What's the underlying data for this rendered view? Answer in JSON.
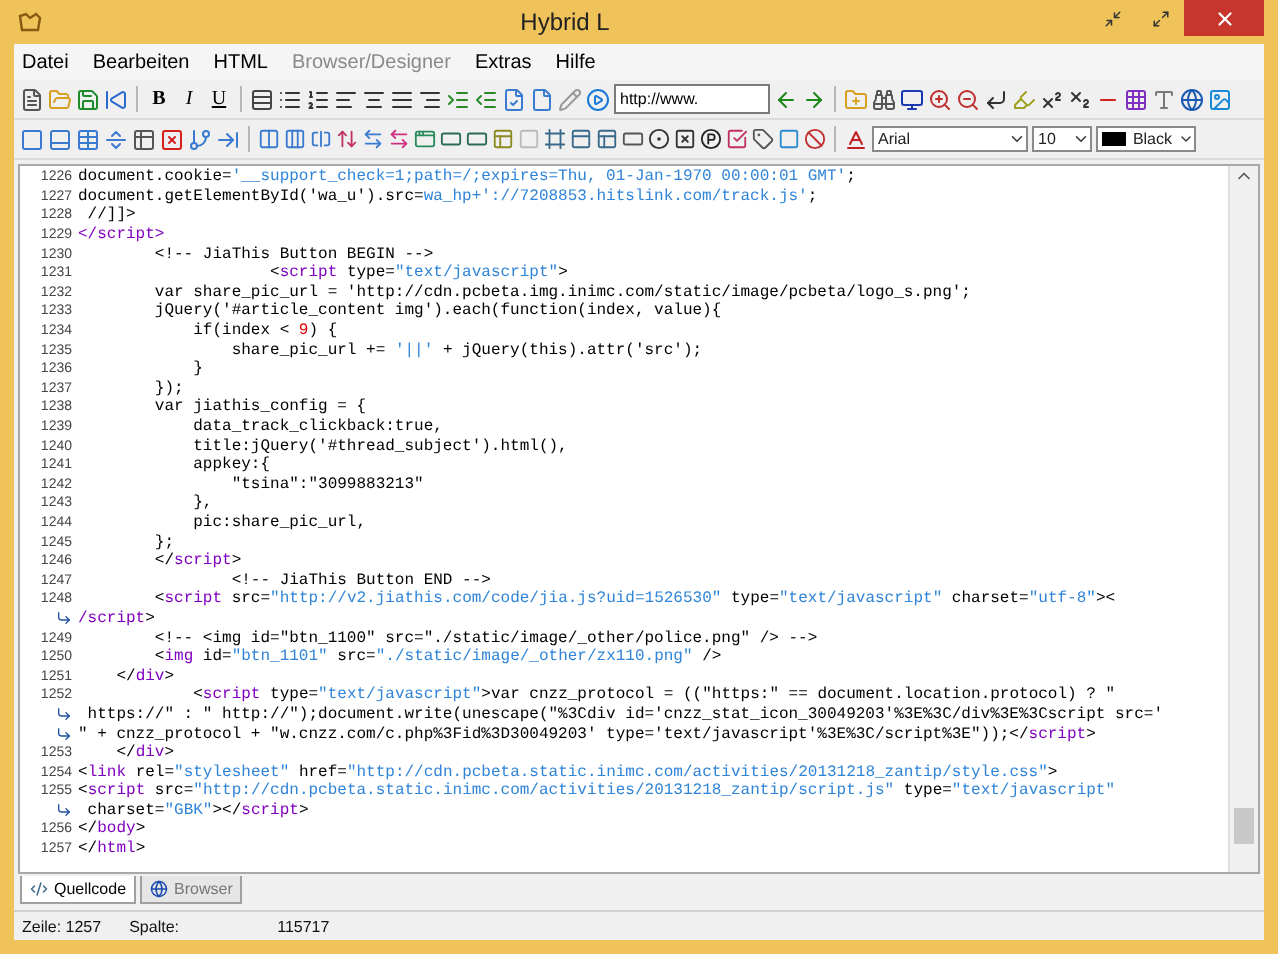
{
  "window": {
    "title": "Hybrid L"
  },
  "menu": [
    {
      "label": "Datei",
      "disabled": false
    },
    {
      "label": "Bearbeiten",
      "disabled": false
    },
    {
      "label": "HTML",
      "disabled": false
    },
    {
      "label": "Browser/Designer",
      "disabled": true
    },
    {
      "label": "Extras",
      "disabled": false
    },
    {
      "label": "Hilfe",
      "disabled": false
    }
  ],
  "format_buttons": [
    {
      "label": "B",
      "kind": "bold"
    },
    {
      "label": "I",
      "kind": "italic"
    },
    {
      "label": "U",
      "kind": "underline"
    }
  ],
  "url_field": {
    "value": "http://www."
  },
  "font_select": {
    "value": "Arial"
  },
  "size_select": {
    "value": "10"
  },
  "color_select": {
    "value": "Black",
    "color": "#000000"
  },
  "code_lines": [
    {
      "kind": "line",
      "number": "1226",
      "segments": [
        {
          "kind": "plain",
          "text": "document.cookie="
        },
        {
          "kind": "string",
          "text": "'__support_check=1;path=/;expires=Thu, 01-Jan-1970 00:00:01 GMT'"
        },
        {
          "kind": "plain",
          "text": ";"
        }
      ]
    },
    {
      "kind": "line",
      "number": "1227",
      "segments": [
        {
          "kind": "plain",
          "text": "document.getElementById('wa_u').src="
        },
        {
          "kind": "string",
          "text": "wa_hp+'://7208853.hitslink.com/track.js'"
        },
        {
          "kind": "plain",
          "text": ";"
        }
      ]
    },
    {
      "kind": "line",
      "number": "1228",
      "segments": [
        {
          "kind": "plain",
          "text": " //]]>"
        }
      ]
    },
    {
      "kind": "line",
      "number": "1229",
      "segments": [
        {
          "kind": "tag",
          "text": "</script>"
        }
      ]
    },
    {
      "kind": "line",
      "number": "1230",
      "segments": [
        {
          "kind": "plain",
          "text": "        <!-- JiaThis Button BEGIN -->"
        }
      ]
    },
    {
      "kind": "line",
      "number": "1231",
      "segments": [
        {
          "kind": "plain",
          "text": "                    <"
        },
        {
          "kind": "tag",
          "text": "script"
        },
        {
          "kind": "plain",
          "text": " type="
        },
        {
          "kind": "string",
          "text": "\"text/javascript\""
        },
        {
          "kind": "plain",
          "text": ">"
        }
      ]
    },
    {
      "kind": "line",
      "number": "1232",
      "segments": [
        {
          "kind": "plain",
          "text": "        var share_pic_url = 'http://cdn.pcbeta.img.inimc.com/static/image/pcbeta/logo_s.png';"
        }
      ]
    },
    {
      "kind": "line",
      "number": "1233",
      "segments": [
        {
          "kind": "plain",
          "text": "        jQuery('#article_content img').each(function(index, value){"
        }
      ]
    },
    {
      "kind": "line",
      "number": "1234",
      "segments": [
        {
          "kind": "plain",
          "text": "            if(index < "
        },
        {
          "kind": "number",
          "text": "9"
        },
        {
          "kind": "plain",
          "text": ") {"
        }
      ]
    },
    {
      "kind": "line",
      "number": "1235",
      "segments": [
        {
          "kind": "plain",
          "text": "                share_pic_url += "
        },
        {
          "kind": "string",
          "text": "'||'"
        },
        {
          "kind": "plain",
          "text": " + jQuery(this).attr('src');"
        }
      ]
    },
    {
      "kind": "line",
      "number": "1236",
      "segments": [
        {
          "kind": "plain",
          "text": "            }"
        }
      ]
    },
    {
      "kind": "line",
      "number": "1237",
      "segments": [
        {
          "kind": "plain",
          "text": "        });"
        }
      ]
    },
    {
      "kind": "line",
      "number": "1238",
      "segments": [
        {
          "kind": "plain",
          "text": "        var jiathis_config = {"
        }
      ]
    },
    {
      "kind": "line",
      "number": "1239",
      "segments": [
        {
          "kind": "plain",
          "text": "            data_track_clickback:true,"
        }
      ]
    },
    {
      "kind": "line",
      "number": "1240",
      "segments": [
        {
          "kind": "plain",
          "text": "            title:jQuery('#thread_subject').html(),"
        }
      ]
    },
    {
      "kind": "line",
      "number": "1241",
      "segments": [
        {
          "kind": "plain",
          "text": "            appkey:{"
        }
      ]
    },
    {
      "kind": "line",
      "number": "1242",
      "segments": [
        {
          "kind": "plain",
          "text": "                \"tsina\":\"3099883213\""
        }
      ]
    },
    {
      "kind": "line",
      "number": "1243",
      "segments": [
        {
          "kind": "plain",
          "text": "            },"
        }
      ]
    },
    {
      "kind": "line",
      "number": "1244",
      "segments": [
        {
          "kind": "plain",
          "text": "            pic:share_pic_url,"
        }
      ]
    },
    {
      "kind": "line",
      "number": "1245",
      "segments": [
        {
          "kind": "plain",
          "text": "        };"
        }
      ]
    },
    {
      "kind": "line",
      "number": "1246",
      "segments": [
        {
          "kind": "plain",
          "text": "        </"
        },
        {
          "kind": "tag",
          "text": "script"
        },
        {
          "kind": "plain",
          "text": ">"
        }
      ]
    },
    {
      "kind": "line",
      "number": "1247",
      "segments": [
        {
          "kind": "plain",
          "text": "                <!-- JiaThis Button END -->"
        }
      ]
    },
    {
      "kind": "line",
      "number": "1248",
      "segments": [
        {
          "kind": "plain",
          "text": "        <"
        },
        {
          "kind": "tag",
          "text": "script"
        },
        {
          "kind": "plain",
          "text": " src="
        },
        {
          "kind": "string",
          "text": "\"http://v2.jiathis.com/code/jia.js?uid=1526530\""
        },
        {
          "kind": "plain",
          "text": " type="
        },
        {
          "kind": "string",
          "text": "\"text/javascript\""
        },
        {
          "kind": "plain",
          "text": " charset="
        },
        {
          "kind": "string",
          "text": "\"utf-8\""
        },
        {
          "kind": "plain",
          "text": "><"
        }
      ]
    },
    {
      "kind": "wrap",
      "segments": [
        {
          "kind": "tag",
          "text": "/script"
        },
        {
          "kind": "plain",
          "text": ">"
        }
      ]
    },
    {
      "kind": "line",
      "number": "1249",
      "segments": [
        {
          "kind": "plain",
          "text": "        <!-- <img id=\"btn_1100\" src=\"./static/image/_other/police.png\" /> -->"
        }
      ]
    },
    {
      "kind": "line",
      "number": "1250",
      "segments": [
        {
          "kind": "plain",
          "text": "        <"
        },
        {
          "kind": "tag",
          "text": "img"
        },
        {
          "kind": "plain",
          "text": " id="
        },
        {
          "kind": "string",
          "text": "\"btn_1101\""
        },
        {
          "kind": "plain",
          "text": " src="
        },
        {
          "kind": "string",
          "text": "\"./static/image/_other/zx110.png\""
        },
        {
          "kind": "plain",
          "text": " />"
        }
      ]
    },
    {
      "kind": "line",
      "number": "1251",
      "segments": [
        {
          "kind": "plain",
          "text": "    </"
        },
        {
          "kind": "tag",
          "text": "div"
        },
        {
          "kind": "plain",
          "text": ">"
        }
      ]
    },
    {
      "kind": "line",
      "number": "1252",
      "segments": [
        {
          "kind": "plain",
          "text": "            <"
        },
        {
          "kind": "tag",
          "text": "script"
        },
        {
          "kind": "plain",
          "text": " type="
        },
        {
          "kind": "string",
          "text": "\"text/javascript\""
        },
        {
          "kind": "plain",
          "text": ">var cnzz_protocol = ((\"https:\" == document.location.protocol) ? \""
        }
      ]
    },
    {
      "kind": "wrap",
      "segments": [
        {
          "kind": "plain",
          "text": " https://\" : \" http://\");document.write(unescape(\"%3Cdiv id='cnzz_stat_icon_30049203'%3E%3C/div%3E%3Cscript src='"
        }
      ]
    },
    {
      "kind": "wrap",
      "segments": [
        {
          "kind": "plain",
          "text": "\" + cnzz_protocol + \"w.cnzz.com/c.php%3Fid%3D30049203' type='text/javascript'%3E%3C/script%3E\"));</"
        },
        {
          "kind": "tag",
          "text": "script"
        },
        {
          "kind": "plain",
          "text": ">"
        }
      ]
    },
    {
      "kind": "line",
      "number": "1253",
      "segments": [
        {
          "kind": "plain",
          "text": "    </"
        },
        {
          "kind": "tag",
          "text": "div"
        },
        {
          "kind": "plain",
          "text": ">"
        }
      ]
    },
    {
      "kind": "line",
      "number": "1254",
      "segments": [
        {
          "kind": "plain",
          "text": "<"
        },
        {
          "kind": "tag",
          "text": "link"
        },
        {
          "kind": "plain",
          "text": " rel="
        },
        {
          "kind": "string",
          "text": "\"stylesheet\""
        },
        {
          "kind": "plain",
          "text": " href="
        },
        {
          "kind": "string",
          "text": "\"http://cdn.pcbeta.static.inimc.com/activities/20131218_zantip/style.css\""
        },
        {
          "kind": "plain",
          "text": ">"
        }
      ]
    },
    {
      "kind": "line",
      "number": "1255",
      "segments": [
        {
          "kind": "plain",
          "text": "<"
        },
        {
          "kind": "tag",
          "text": "script"
        },
        {
          "kind": "plain",
          "text": " src="
        },
        {
          "kind": "string",
          "text": "\"http://cdn.pcbeta.static.inimc.com/activities/20131218_zantip/script.js\""
        },
        {
          "kind": "plain",
          "text": " type="
        },
        {
          "kind": "string",
          "text": "\"text/javascript\""
        }
      ]
    },
    {
      "kind": "wrap",
      "segments": [
        {
          "kind": "plain",
          "text": " charset="
        },
        {
          "kind": "string",
          "text": "\"GBK\""
        },
        {
          "kind": "plain",
          "text": "></"
        },
        {
          "kind": "tag",
          "text": "script"
        },
        {
          "kind": "plain",
          "text": ">"
        }
      ]
    },
    {
      "kind": "line",
      "number": "1256",
      "segments": [
        {
          "kind": "plain",
          "text": "</"
        },
        {
          "kind": "tag",
          "text": "body"
        },
        {
          "kind": "plain",
          "text": ">"
        }
      ]
    },
    {
      "kind": "line",
      "number": "1257",
      "segments": [
        {
          "kind": "plain",
          "text": "</"
        },
        {
          "kind": "tag",
          "text": "html"
        },
        {
          "kind": "plain",
          "text": ">"
        }
      ]
    }
  ],
  "view_tabs": [
    {
      "label": "Quellcode",
      "selected": true
    },
    {
      "label": "Browser",
      "selected": false
    }
  ],
  "status_bar": {
    "line_label": "Zeile: 1257",
    "column_label": "Spalte:",
    "column_value": "115717"
  }
}
